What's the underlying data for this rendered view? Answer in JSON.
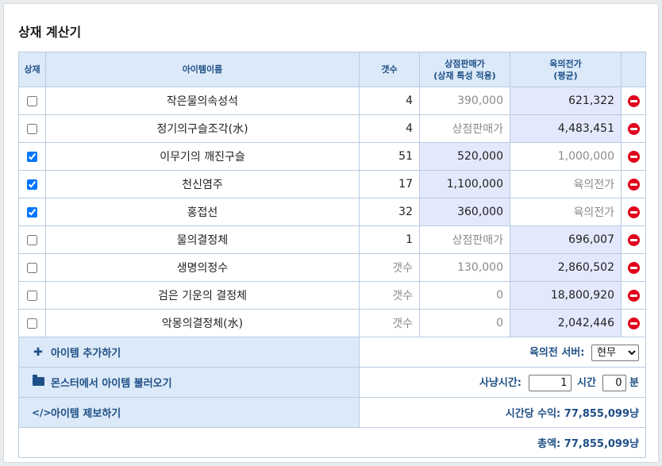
{
  "title": "상재 계산기",
  "headers": {
    "check": "상재",
    "name": "아이템이름",
    "count": "갯수",
    "shop_price": "상점판매가",
    "shop_price_sub": "(상재 특성 적용)",
    "unit_price": "육의전가",
    "unit_price_sub": "(평균)"
  },
  "rows": [
    {
      "checked": false,
      "name": "작은물의속성석",
      "count": "4",
      "shop": "390,000",
      "price": "621,322"
    },
    {
      "checked": false,
      "name": "정기의구슬조각(水)",
      "count": "4",
      "shop": "상점판매가",
      "price": "4,483,451"
    },
    {
      "checked": true,
      "name": "이무기의 깨진구슬",
      "count": "51",
      "shop": "520,000",
      "price": "1,000,000"
    },
    {
      "checked": true,
      "name": "천신염주",
      "count": "17",
      "shop": "1,100,000",
      "price": "육의전가"
    },
    {
      "checked": true,
      "name": "홍접선",
      "count": "32",
      "shop": "360,000",
      "price": "육의전가"
    },
    {
      "checked": false,
      "name": "물의결정체",
      "count": "1",
      "shop": "상점판매가",
      "price": "696,007"
    },
    {
      "checked": false,
      "name": "생명의정수",
      "count": "갯수",
      "shop": "130,000",
      "price": "2,860,502"
    },
    {
      "checked": false,
      "name": "검은 기운의 결정체",
      "count": "갯수",
      "shop": "0",
      "price": "18,800,920"
    },
    {
      "checked": false,
      "name": "악몽의결정체(水)",
      "count": "갯수",
      "shop": "0",
      "price": "2,042,446"
    }
  ],
  "actions": {
    "add_item": "아이템 추가하기",
    "load_monster": "몬스터에서 아이템 불러오기",
    "report_item": "아이템 제보하기"
  },
  "server": {
    "label": "육의전 서버:",
    "selected": "현무"
  },
  "hunt": {
    "label": "사냥시간:",
    "hours": "1",
    "hours_unit": "시간",
    "minutes": "0",
    "minutes_unit": "분"
  },
  "hourly": "시간당 수익: 77,855,099냥",
  "total": "총액: 77,855,099냥",
  "colors": {
    "header_bg": "#dbe9f8",
    "header_text": "#1e4f86",
    "border": "#b9cbe0",
    "highlight": "#e3e8fc",
    "delete": "#e0001b"
  }
}
